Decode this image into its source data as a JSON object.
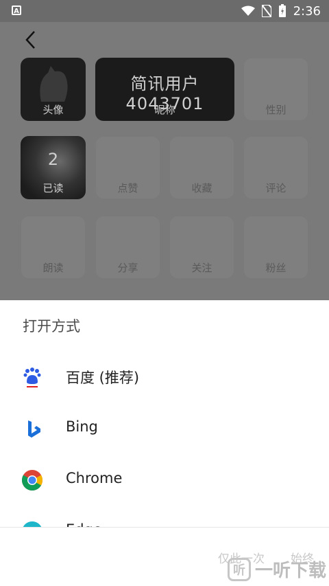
{
  "status": {
    "time": "2:36",
    "notify_letter": "A"
  },
  "profile": {
    "avatar_label": "头像",
    "nickname_value": "简讯用户4043701",
    "nickname_label": "昵称",
    "gender_label": "性别",
    "read_count": "2",
    "read_label": "已读",
    "like_label": "点赞",
    "fav_label": "收藏",
    "comment_label": "评论",
    "readaloud_label": "朗读",
    "share_label": "分享",
    "follow_label": "关注",
    "fans_label": "粉丝"
  },
  "sheet": {
    "title": "打开方式",
    "apps": [
      {
        "name": "百度 (推荐)",
        "icon": "baidu-icon"
      },
      {
        "name": "Bing",
        "icon": "bing-icon"
      },
      {
        "name": "Chrome",
        "icon": "chrome-icon"
      },
      {
        "name": "Edge",
        "icon": "edge-icon"
      }
    ],
    "once_label": "仅此一次",
    "always_label": "始终"
  },
  "watermark": {
    "text": "一听下载"
  },
  "colors": {
    "sheet_bg": "#ffffff",
    "overlay": "#7a7a7a",
    "baidu_blue": "#2d5be3",
    "bing_blue": "#1a6fd8"
  }
}
